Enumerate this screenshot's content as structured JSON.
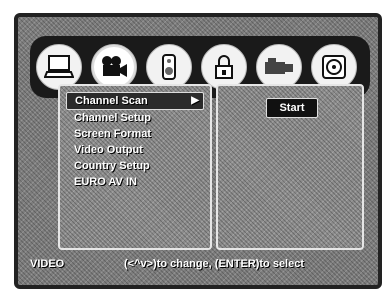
{
  "icon_bar": {
    "icons": [
      {
        "name": "general-setup-icon",
        "active": false
      },
      {
        "name": "video-setup-icon",
        "active": true
      },
      {
        "name": "audio-setup-icon",
        "active": false
      },
      {
        "name": "parental-lock-icon",
        "active": false
      },
      {
        "name": "record-setup-icon",
        "active": false
      },
      {
        "name": "disc-setup-icon",
        "active": false
      }
    ]
  },
  "menu": {
    "items": [
      {
        "label": "Channel Scan",
        "selected": true
      },
      {
        "label": "Channel Setup"
      },
      {
        "label": "Screen Format"
      },
      {
        "label": "Video Output"
      },
      {
        "label": "Country Setup"
      },
      {
        "label": "EURO AV IN"
      }
    ],
    "arrow": "▶"
  },
  "detail": {
    "start_label": "Start"
  },
  "status_bar": {
    "mode": "VIDEO",
    "hint": "(<^v>)to change, (ENTER)to select"
  },
  "colors": {
    "frame": "#1a1a1a",
    "selection": "#2b2b2b",
    "text": "#ffffff"
  }
}
